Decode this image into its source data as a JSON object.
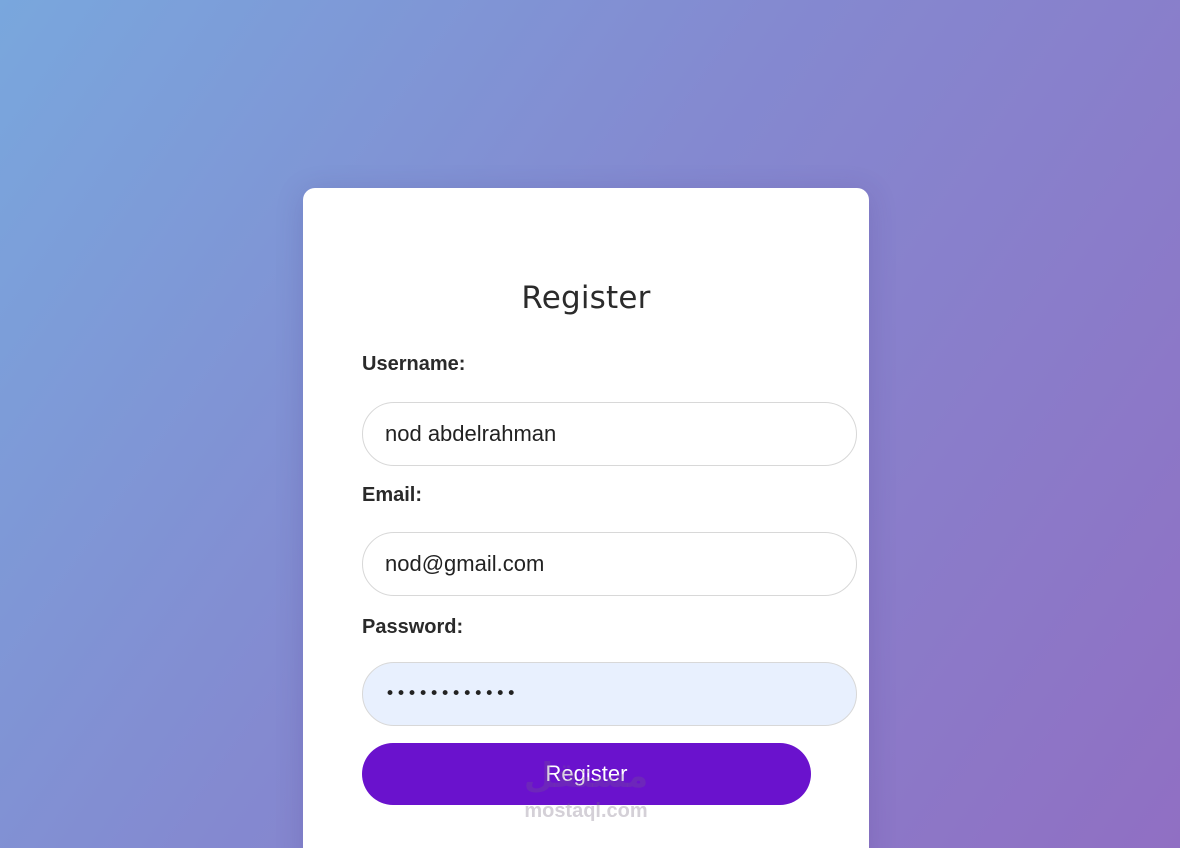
{
  "form": {
    "title": "Register",
    "username_label": "Username:",
    "username_value": "nod abdelrahman",
    "email_label": "Email:",
    "email_value": "nod@gmail.com",
    "password_label": "Password:",
    "password_value": "••••••••••••",
    "submit_label": "Register"
  },
  "watermark": {
    "logo": "مستقل",
    "text": "mostaql.com"
  },
  "colors": {
    "gradient_start": "#79a7dd",
    "gradient_end": "#906fc3",
    "button": "#6a12cd",
    "autofill": "#e8f0fe"
  }
}
